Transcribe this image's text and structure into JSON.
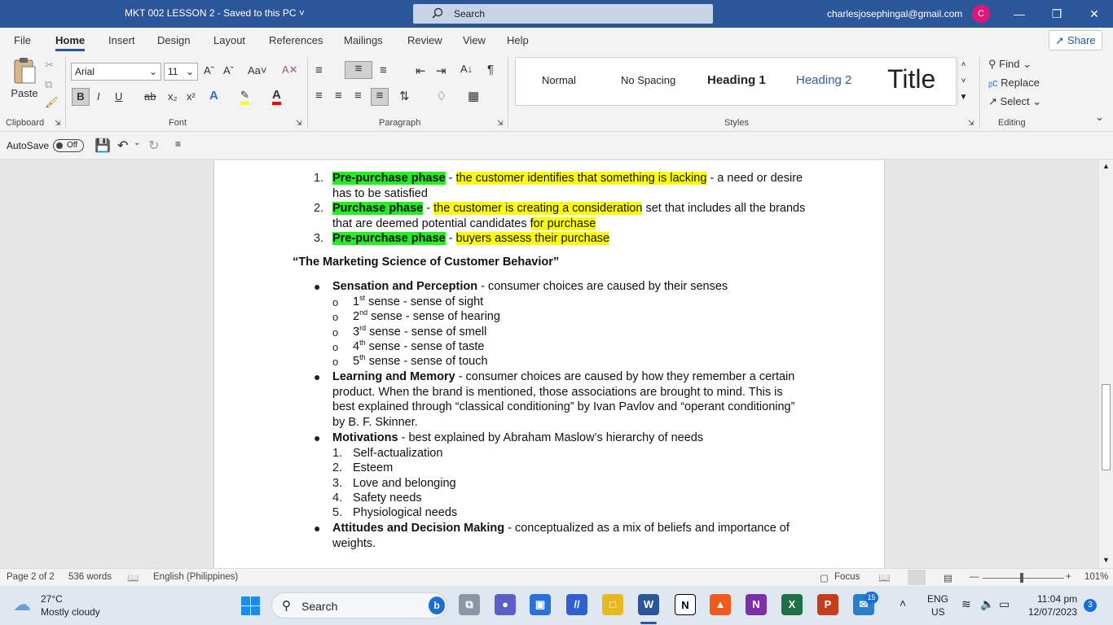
{
  "window": {
    "doc_title": "MKT 002 LESSON 2  -  Saved to this PC  ˅",
    "search_placeholder": "Search",
    "account": "charlesjosephingal@gmail.com",
    "avatar_letter": "C"
  },
  "menu": {
    "tabs": [
      "File",
      "Home",
      "Insert",
      "Design",
      "Layout",
      "References",
      "Mailings",
      "Review",
      "View",
      "Help"
    ],
    "share": "Share"
  },
  "ribbon": {
    "paste": "Paste",
    "font_name": "Arial",
    "font_size": "11",
    "groups": [
      "Clipboard",
      "Font",
      "Paragraph",
      "Styles",
      "Editing"
    ],
    "styles": [
      "Normal",
      "No Spacing",
      "Heading 1",
      "Heading 2",
      "Title"
    ],
    "find": "Find",
    "replace": "Replace",
    "select": "Select"
  },
  "qat": {
    "autosave": "AutoSave",
    "autosave_state": "Off"
  },
  "document": {
    "phases": [
      {
        "num": "1.",
        "label": "Pre-purchase phase",
        "sep": " - ",
        "hl": "the customer identifies that something is lacking",
        "rest": " - a need or desire",
        "line2": "has to be satisfied"
      },
      {
        "num": "2.",
        "label": "Purchase phase",
        "sep": " - ",
        "hl": "the customer is creating a consideration",
        "rest": " set that includes all the brands",
        "line2a": "that are deemed potential candidates ",
        "line2hl": "for purchase"
      },
      {
        "num": "3.",
        "label": "Pre-purchase phase",
        "sep": " - ",
        "hl": "buyers assess their purchase"
      }
    ],
    "heading": "“The Marketing Science of Customer Behavior”",
    "sensation": {
      "label": "Sensation and Perception",
      "text": " - consumer choices are caused by their senses"
    },
    "senses": [
      {
        "n": "1",
        "sup": "st",
        "text": " sense - sense of sight"
      },
      {
        "n": "2",
        "sup": "nd",
        "text": " sense - sense of hearing"
      },
      {
        "n": "3",
        "sup": "rd",
        "text": " sense - sense of smell"
      },
      {
        "n": "4",
        "sup": "th",
        "text": " sense - sense of taste"
      },
      {
        "n": "5",
        "sup": "th",
        "text": " sense - sense of touch"
      }
    ],
    "learning": {
      "label": "Learning and Memory",
      "line1": " - consumer choices are caused by how they remember a certain",
      "line2": "product. When the brand is mentioned, those associations are brought to mind. This is",
      "line3": "best explained through “classical conditioning” by Ivan Pavlov and “operant conditioning”",
      "line4": "by B. F. Skinner."
    },
    "motivations": {
      "label": "Motivations",
      "text": " - best explained by Abraham Maslow’s hierarchy of needs"
    },
    "needs": [
      {
        "n": "1.",
        "text": "Self-actualization"
      },
      {
        "n": "2.",
        "text": "Esteem"
      },
      {
        "n": "3.",
        "text": "Love and belonging"
      },
      {
        "n": "4.",
        "text": "Safety needs"
      },
      {
        "n": "5.",
        "text": "Physiological needs"
      }
    ],
    "attitudes": {
      "label": "Attitudes and Decision Making",
      "line1": " - conceptualized as a mix of beliefs and importance of",
      "line2": "weights."
    }
  },
  "status": {
    "page": "Page 2 of 2",
    "words": "536 words",
    "language": "English (Philippines)",
    "focus": "Focus",
    "zoom": "101%"
  },
  "taskbar": {
    "temp": "27°C",
    "weather": "Mostly cloudy",
    "search": "Search",
    "lang1": "ENG",
    "lang2": "US",
    "time": "11:04 pm",
    "date": "12/07/2023",
    "notif": "3",
    "badge": "15"
  }
}
